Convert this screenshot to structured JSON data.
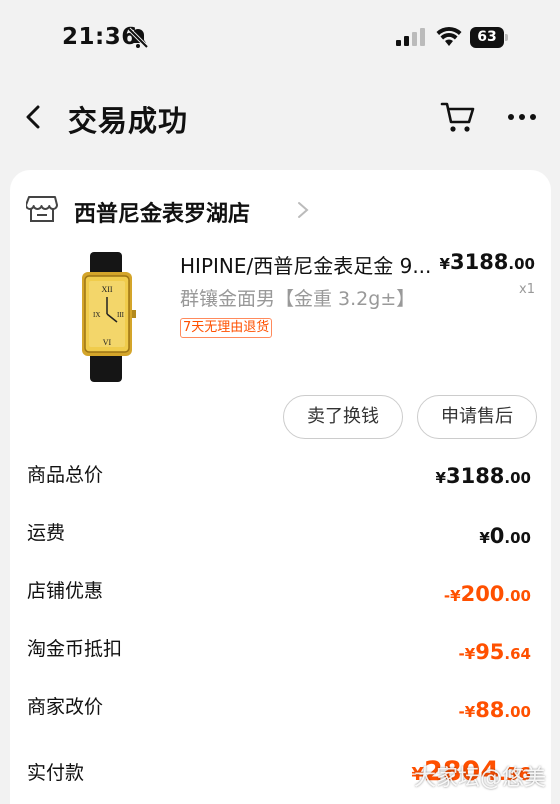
{
  "status_bar": {
    "time": "21:36",
    "battery": "63",
    "icons": [
      "bell-slash-icon",
      "signal-icon",
      "wifi-icon",
      "battery-icon"
    ]
  },
  "nav": {
    "title": "交易成功",
    "icons": [
      "back-icon",
      "cart-icon",
      "more-icon"
    ]
  },
  "shop": {
    "name": "西普尼金表罗湖店",
    "icon": "store-icon"
  },
  "product": {
    "title": "HIPINE/西普尼金表足金 9...",
    "spec": "群镶金面男【金重 3.2g±】",
    "tag": "7天无理由退货",
    "price_symbol": "¥",
    "price_int": "3188",
    "price_dec": ".00",
    "quantity": "x1"
  },
  "actions": {
    "sell": "卖了换钱",
    "after_sale": "申请售后"
  },
  "fees": [
    {
      "label": "商品总价",
      "sign": "",
      "symbol": "¥",
      "int": "3188",
      "dec": ".00",
      "color": "#111111"
    },
    {
      "label": "运费",
      "sign": "",
      "symbol": "¥",
      "int": "0",
      "dec": ".00",
      "color": "#111111"
    },
    {
      "label": "店铺优惠",
      "sign": "-",
      "symbol": "¥",
      "int": "200",
      "dec": ".00",
      "color": "#ff5000"
    },
    {
      "label": "淘金币抵扣",
      "sign": "-",
      "symbol": "¥",
      "int": "95",
      "dec": ".64",
      "color": "#ff5000"
    },
    {
      "label": "商家改价",
      "sign": "-",
      "symbol": "¥",
      "int": "88",
      "dec": ".00",
      "color": "#ff5000"
    }
  ],
  "paid": {
    "label": "实付款",
    "symbol": "¥",
    "int": "2804",
    "dec": ".36"
  },
  "watermark": "大家坛@悠美",
  "colors": {
    "accent": "#ff5000",
    "background": "#f2f2f2",
    "card": "#ffffff"
  }
}
